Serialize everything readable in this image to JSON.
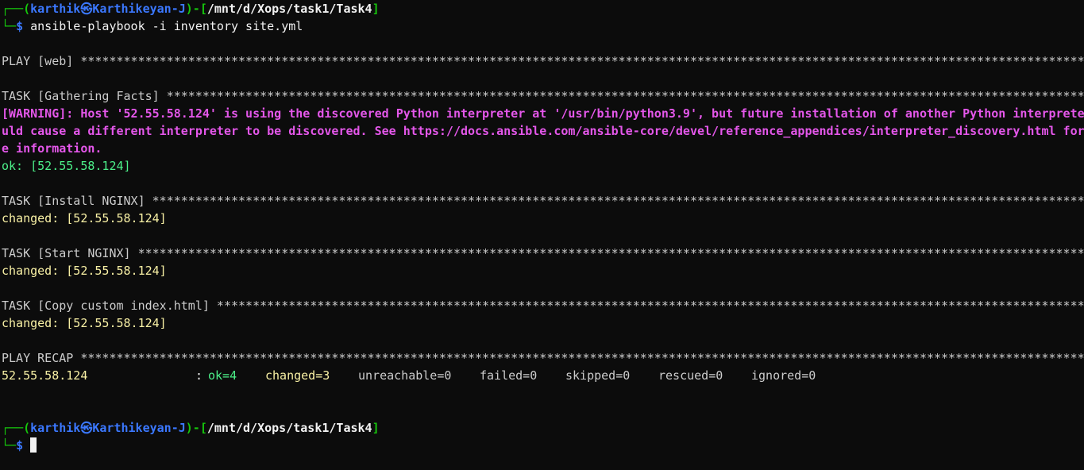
{
  "prompt": {
    "frame_top": "┌──",
    "frame_bottom": "└─",
    "open_paren": "(",
    "user": "karthik",
    "at_symbol": "㉿",
    "host": "Karthikeyan-J",
    "close_paren": ")",
    "dash": "-",
    "open_bracket": "[",
    "path": "/mnt/d/Xops/task1/Task4",
    "close_bracket": "]",
    "dollar": "$"
  },
  "command": "ansible-playbook -i inventory site.yml",
  "play_line": "PLAY [web] *************************************************************************************************************************************************************************",
  "task_gather": "TASK [Gathering Facts] ***************************************************************************************************************************************************",
  "warning_lines": [
    "[WARNING]: Host '52.55.58.124' is using the discovered Python interpreter at '/usr/bin/python3.9', but future installation of another Python interpreter co",
    "uld cause a different interpreter to be discovered. See https://docs.ansible.com/ansible-core/devel/reference_appendices/interpreter_discovery.html for mor",
    "e information."
  ],
  "ok_line": "ok: [52.55.58.124]",
  "task_install": "TASK [Install NGINX] *****************************************************************************************************************************************************",
  "changed_install": "changed: [52.55.58.124]",
  "task_start": "TASK [Start NGINX] *******************************************************************************************************************************************************",
  "changed_start": "changed: [52.55.58.124]",
  "task_copy": "TASK [Copy custom index.html] ********************************************************************************************************************************************",
  "changed_copy": "changed: [52.55.58.124]",
  "recap_line": "PLAY RECAP ***************************************************************************************************************************************************************",
  "recap": {
    "host": "52.55.58.124",
    "colon": ":",
    "ok": "ok=4",
    "changed": "changed=3",
    "unreachable": "unreachable=0",
    "failed": "failed=0",
    "skipped": "skipped=0",
    "rescued": "rescued=0",
    "ignored": "ignored=0"
  },
  "colors": {
    "background": "#0c0c0c",
    "prompt_blue": "#3b78ff",
    "prompt_green": "#16c60c",
    "ok_green": "#4cf089",
    "changed_yellow": "#f9f1a5",
    "warning_magenta": "#e457ea",
    "text": "#cccccc"
  }
}
